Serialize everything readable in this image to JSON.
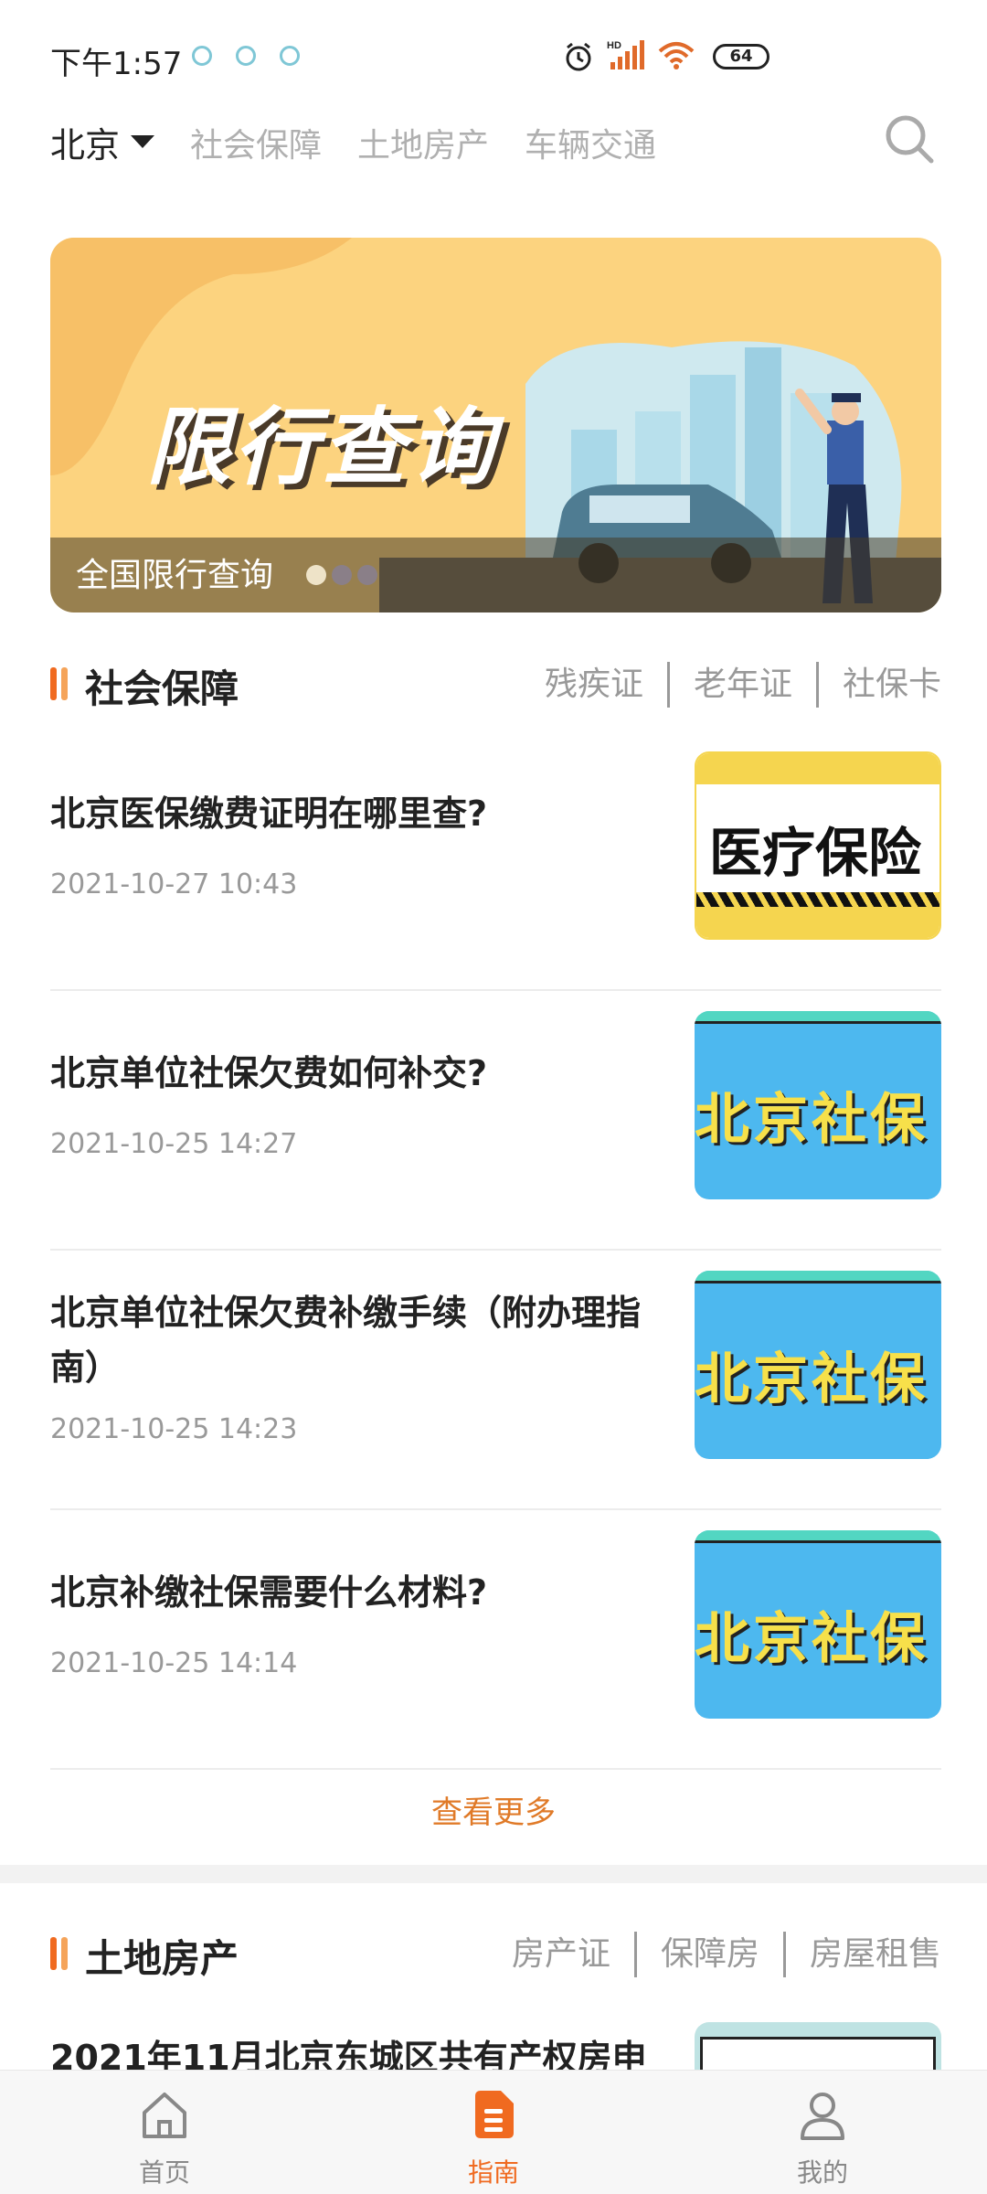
{
  "status_bar": {
    "time": "下午1:57",
    "battery": "64",
    "network": "HD"
  },
  "topnav": {
    "city": "北京",
    "tabs": [
      "社会保障",
      "土地房产",
      "车辆交通"
    ]
  },
  "banner": {
    "title": "限行查询",
    "caption": "全国限行查询",
    "active_dot": 0
  },
  "section_social": {
    "title": "社会保障",
    "links": [
      "残疾证",
      "老年证",
      "社保卡"
    ]
  },
  "articles": [
    {
      "title": "北京医保缴费证明在哪里查?",
      "time": "2021-10-27 10:43",
      "thumb_text": "医疗保险"
    },
    {
      "title": "北京单位社保欠费如何补交?",
      "time": "2021-10-25 14:27",
      "thumb_text": "北京社保"
    },
    {
      "title": "北京单位社保欠费补缴手续（附办理指南）",
      "time": "2021-10-25 14:23",
      "thumb_text": "北京社保"
    },
    {
      "title": "北京补缴社保需要什么材料?",
      "time": "2021-10-25 14:14",
      "thumb_text": "北京社保"
    }
  ],
  "more_label": "查看更多",
  "section_land": {
    "title": "土地房产",
    "links": [
      "房产证",
      "保障房",
      "房屋租售"
    ],
    "peek_title": "2021年11月北京东城区共有产权房申"
  },
  "tabbar": {
    "items": [
      {
        "label": "首页",
        "icon": "home-icon"
      },
      {
        "label": "指南",
        "icon": "guide-icon"
      },
      {
        "label": "我的",
        "icon": "user-icon"
      }
    ],
    "active": 1
  },
  "colors": {
    "accent": "#f06a20",
    "banner_bg": "#fcd37f"
  }
}
